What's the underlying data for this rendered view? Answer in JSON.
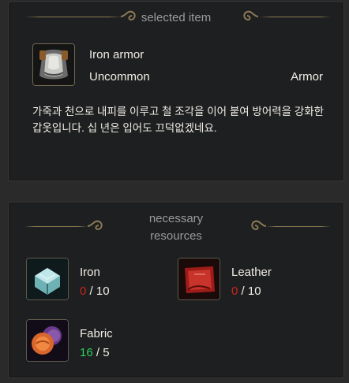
{
  "selected_item": {
    "header": "selected item",
    "name": "Iron armor",
    "rarity": "Uncommon",
    "category": "Armor",
    "icon": "iron-armor-icon",
    "description": "가죽과 천으로 내피를 이루고 철 조각을 이어 붙여 방어력을 강화한 갑옷입니다. 십 년은 입어도 끄덕없겠네요."
  },
  "resources": {
    "header_line1": "necessary",
    "header_line2": "resources",
    "items": [
      {
        "name": "Iron",
        "have": "0",
        "need": "10",
        "icon": "iron-ingot-icon",
        "status": "insufficient"
      },
      {
        "name": "Leather",
        "have": "0",
        "need": "10",
        "icon": "leather-icon",
        "status": "insufficient"
      },
      {
        "name": "Fabric",
        "have": "16",
        "need": "5",
        "icon": "fabric-icon",
        "status": "sufficient"
      }
    ],
    "separator": " / "
  },
  "colors": {
    "insufficient": "#c8261e",
    "sufficient": "#2bd35a",
    "ornament": "#8a7a55"
  }
}
